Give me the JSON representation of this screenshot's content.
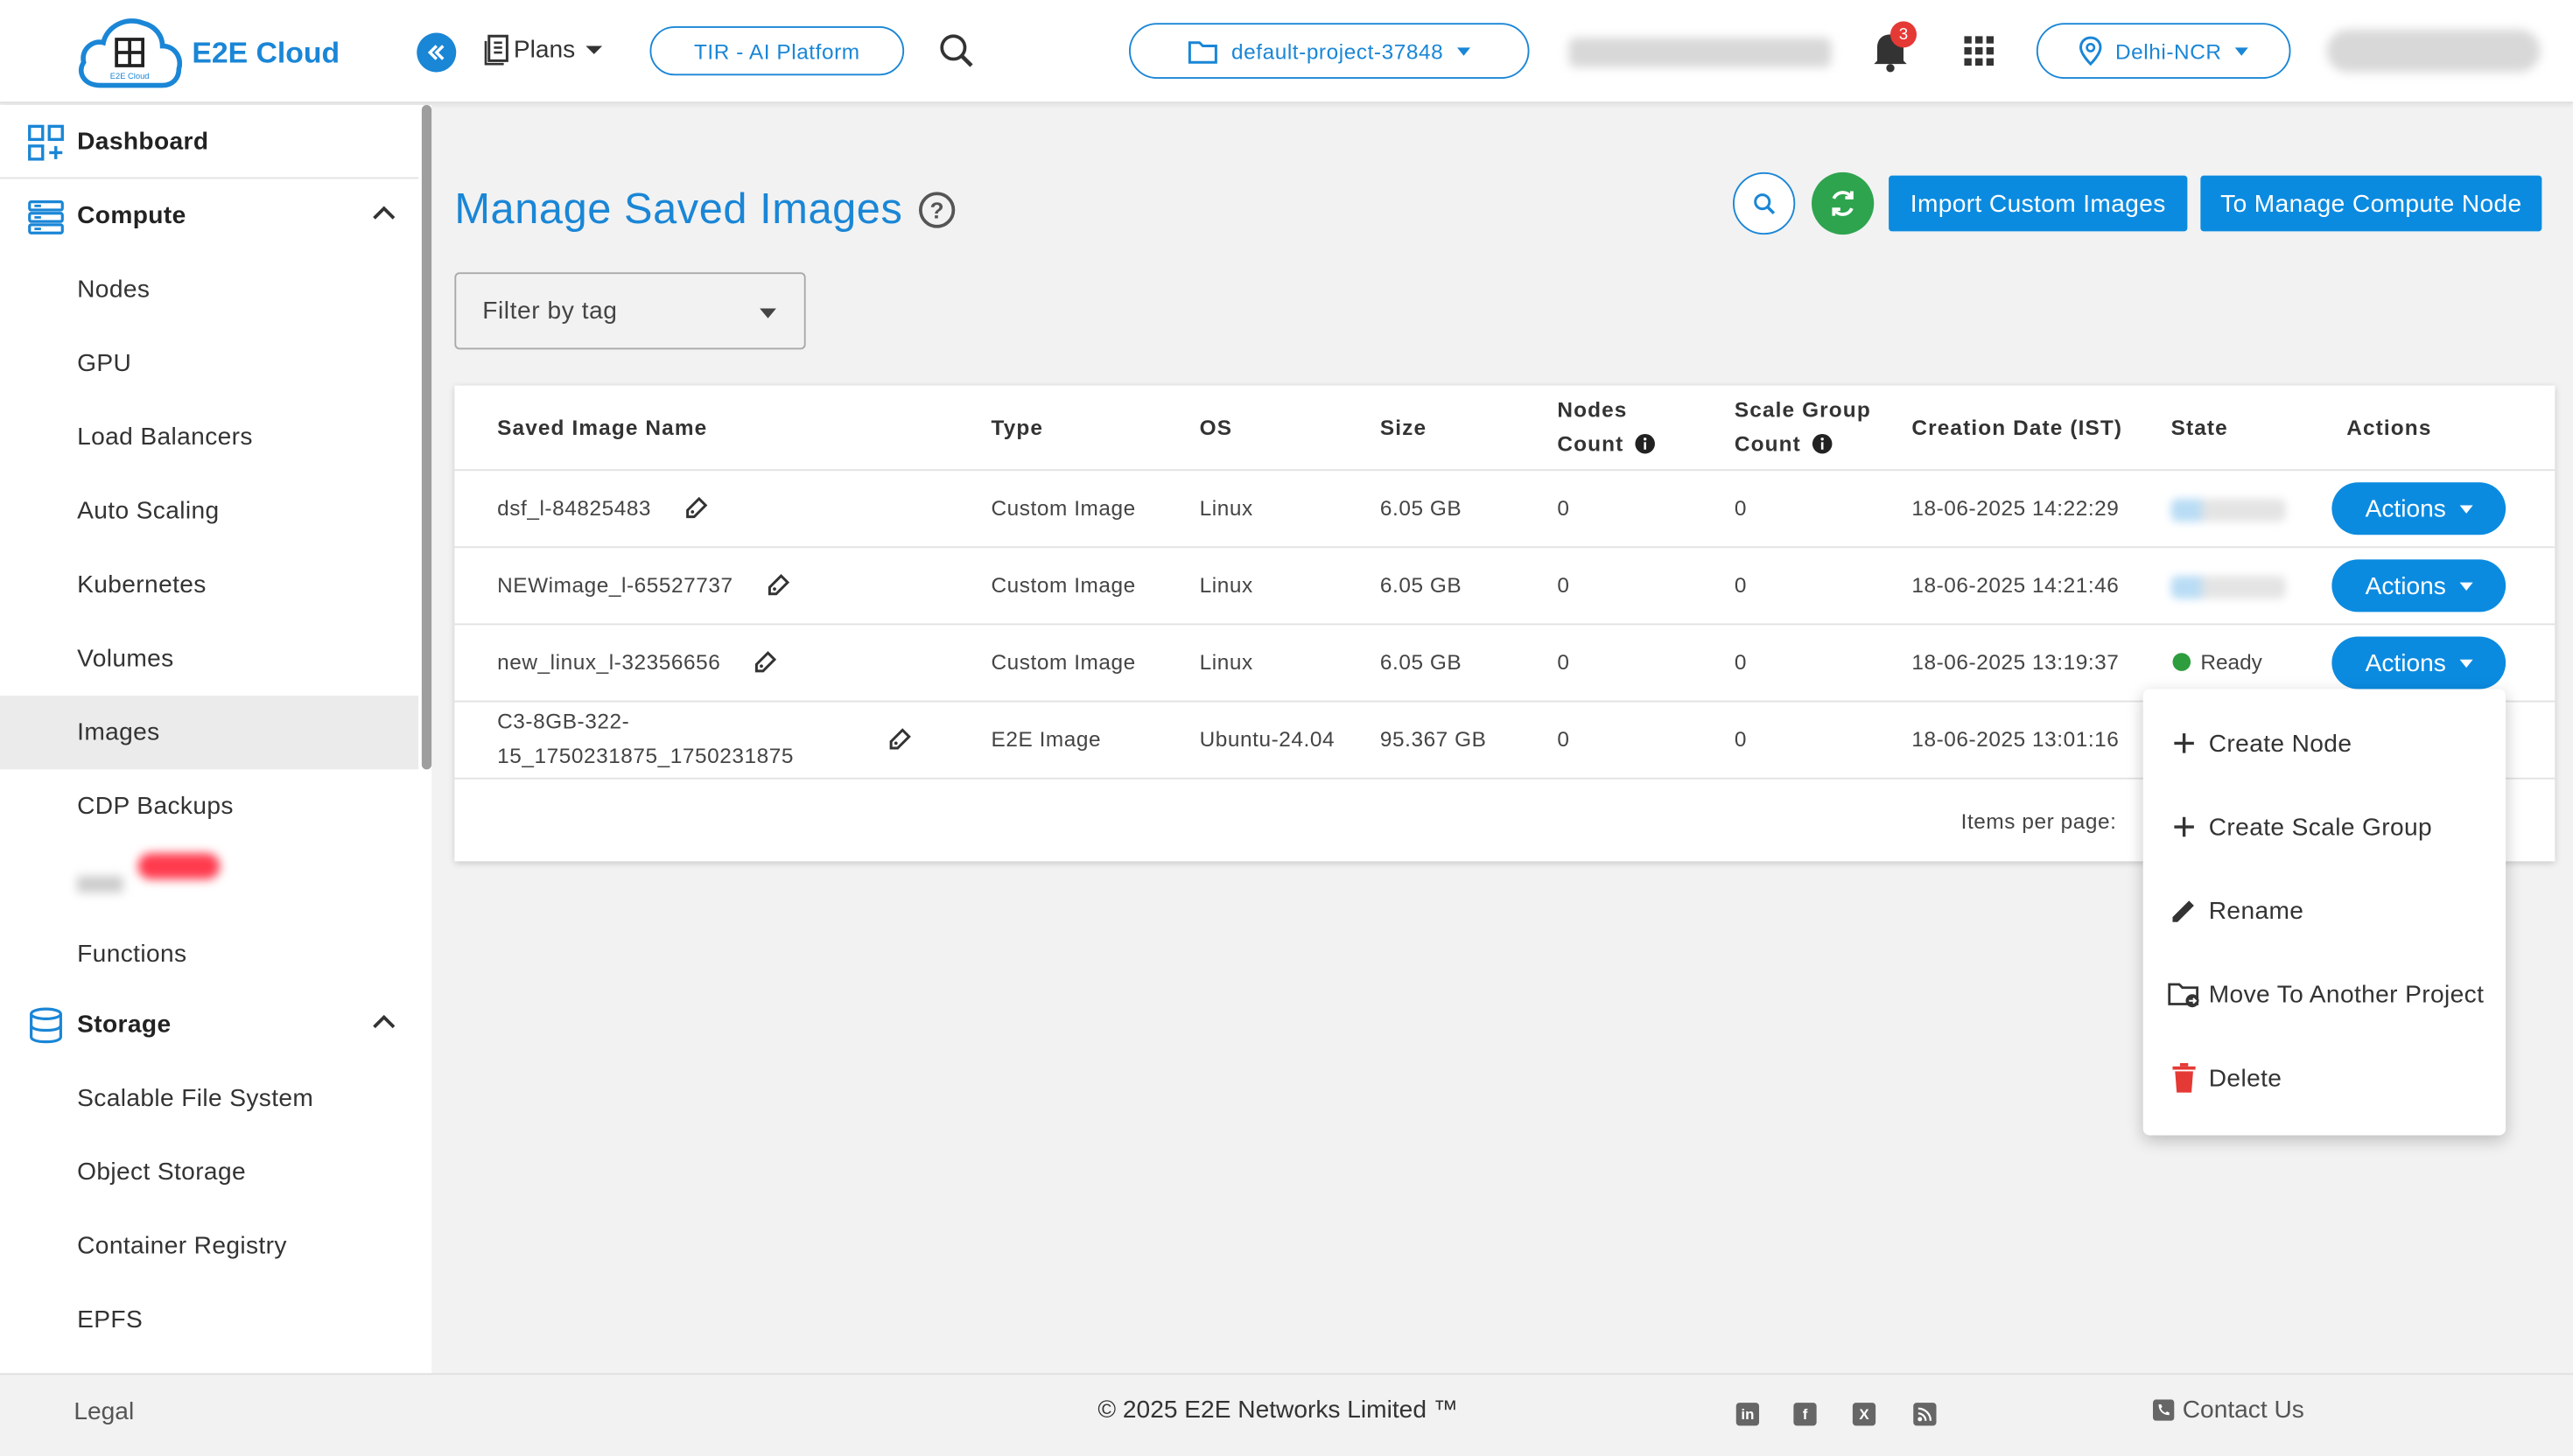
{
  "header": {
    "brand": "E2E Cloud",
    "brand_small": "E2E Cloud",
    "plans_label": "Plans",
    "tir_label": "TIR - AI Platform",
    "project_label": "default-project-37848",
    "notification_count": "3",
    "region_label": "Delhi-NCR"
  },
  "sidebar": {
    "dashboard": "Dashboard",
    "compute": {
      "label": "Compute",
      "items": [
        "Nodes",
        "GPU",
        "Load Balancers",
        "Auto Scaling",
        "Kubernetes",
        "Volumes",
        "Images",
        "CDP Backups",
        "Functions"
      ],
      "active": "Images"
    },
    "storage": {
      "label": "Storage",
      "items": [
        "Scalable File System",
        "Object Storage",
        "Container Registry",
        "EPFS"
      ]
    }
  },
  "main": {
    "title": "Manage Saved Images",
    "import_button": "Import Custom Images",
    "manage_button": "To Manage Compute Node",
    "filter_placeholder": "Filter by tag",
    "columns": {
      "name": "Saved Image Name",
      "type": "Type",
      "os": "OS",
      "size": "Size",
      "nodes_count_1": "Nodes",
      "nodes_count_2": "Count",
      "scale_group_1": "Scale Group",
      "scale_group_2": "Count",
      "creation_date": "Creation Date (IST)",
      "state": "State",
      "actions": "Actions"
    },
    "rows": [
      {
        "name": "dsf_l-84825483",
        "type": "Custom Image",
        "os": "Linux",
        "size": "6.05 GB",
        "nodes": "0",
        "scale": "0",
        "date": "18-06-2025 14:22:29",
        "state": ""
      },
      {
        "name": "NEWimage_l-65527737",
        "type": "Custom Image",
        "os": "Linux",
        "size": "6.05 GB",
        "nodes": "0",
        "scale": "0",
        "date": "18-06-2025 14:21:46",
        "state": ""
      },
      {
        "name": "new_linux_l-32356656",
        "type": "Custom Image",
        "os": "Linux",
        "size": "6.05 GB",
        "nodes": "0",
        "scale": "0",
        "date": "18-06-2025 13:19:37",
        "state": "Ready"
      },
      {
        "name_line1": "C3-8GB-322-",
        "name_line2": "15_1750231875_1750231875",
        "type": "E2E Image",
        "os": "Ubuntu-24.04",
        "size": "95.367 GB",
        "nodes": "0",
        "scale": "0",
        "date": "18-06-2025 13:01:16",
        "state": ""
      }
    ],
    "actions_label": "Actions",
    "items_per_page": "Items per page:"
  },
  "menu": {
    "create_node": "Create Node",
    "create_scale_group": "Create Scale Group",
    "rename": "Rename",
    "move": "Move To Another Project",
    "delete": "Delete"
  },
  "footer": {
    "legal": "Legal",
    "copyright": "© 2025 E2E Networks Limited ™",
    "contact": "Contact Us"
  },
  "colors": {
    "accent": "#1a86d6",
    "button": "#0b8be0",
    "refresh": "#2ea44f",
    "ready": "#2e9d3e",
    "delete": "#e53935"
  }
}
